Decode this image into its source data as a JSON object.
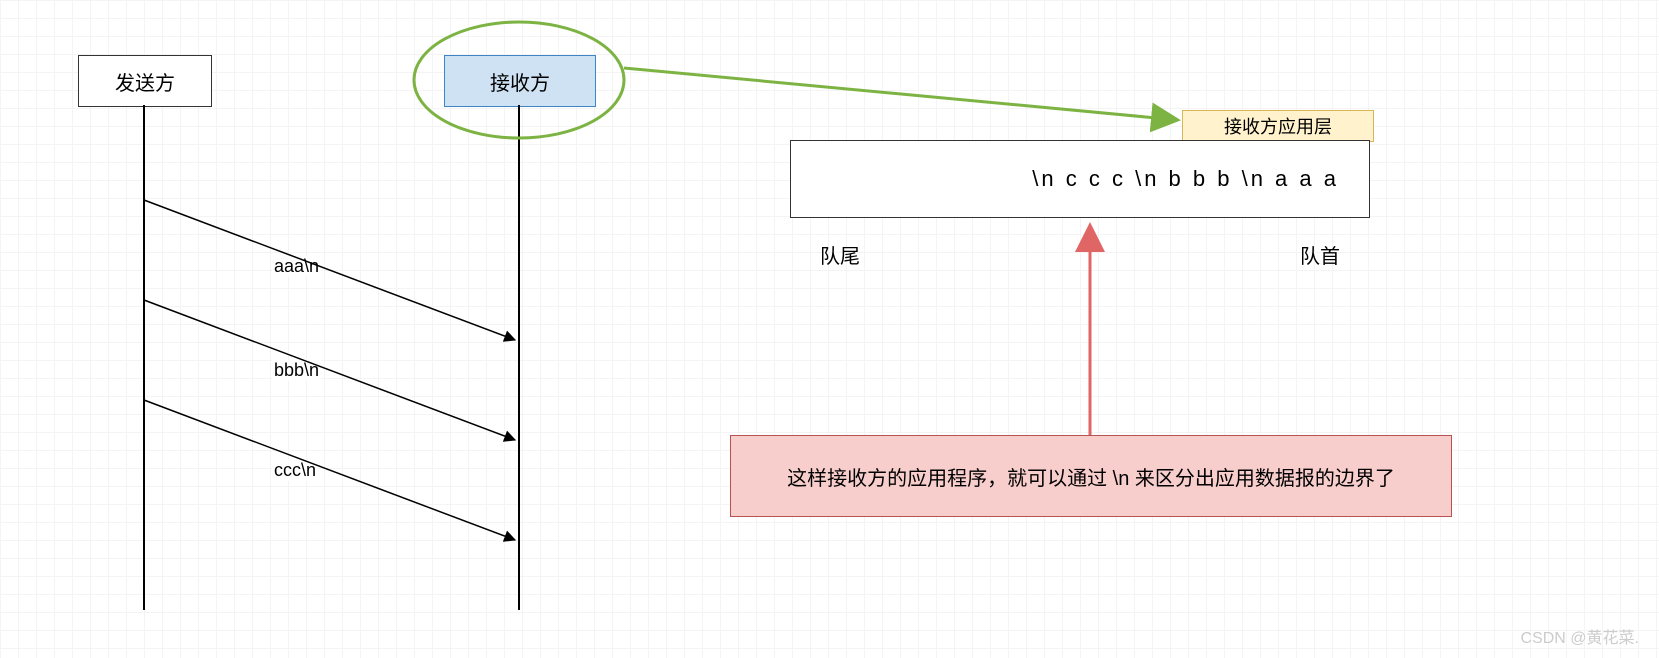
{
  "sender_label": "发送方",
  "receiver_label": "接收方",
  "app_layer_label": "接收方应用层",
  "buffer_content": "\\n c c c \\n b b b \\n a a a",
  "queue_tail": "队尾",
  "queue_head": "队首",
  "messages": {
    "m1": "aaa\\n",
    "m2": "bbb\\n",
    "m3": "ccc\\n"
  },
  "explanation": "这样接收方的应用程序，就可以通过 \\n 来区分出应用数据报的边界了",
  "watermark": "CSDN @黄花菜."
}
